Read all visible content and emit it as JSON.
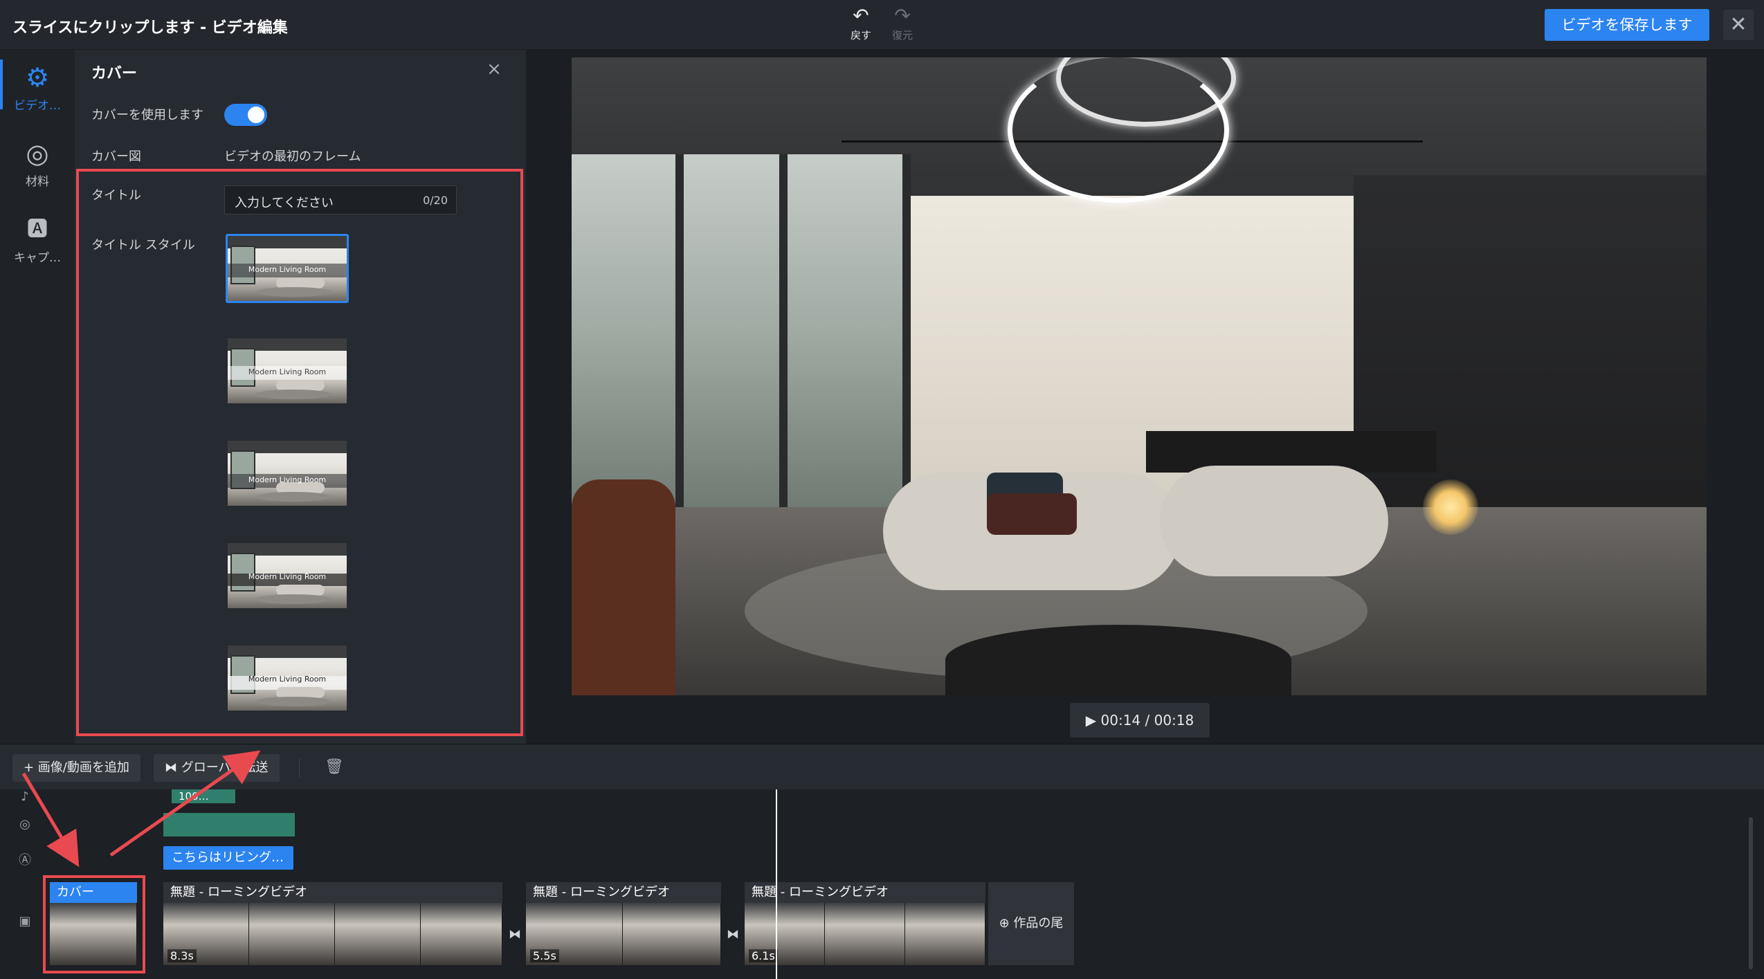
{
  "window": {
    "title": "スライスにクリップします - ビデオ編集",
    "undo_label": "戻す",
    "redo_label": "復元",
    "save_label": "ビデオを保存します",
    "close_icon": "close-icon"
  },
  "rail": {
    "items": [
      {
        "icon": "gear-icon",
        "label": "ビデオ…",
        "active": true
      },
      {
        "icon": "material-icon",
        "label": "材料",
        "active": false
      },
      {
        "icon": "caption-icon",
        "label": "キャプ…",
        "active": false
      }
    ]
  },
  "panel": {
    "title": "カバー",
    "use_cover_label": "カバーを使用します",
    "use_cover_on": true,
    "cover_image_label": "カバー図",
    "cover_image_value": "ビデオの最初のフレーム",
    "title_label": "タイトル",
    "title_placeholder": "入力してください",
    "title_count": "0/20",
    "title_style_label": "タイトル スタイル",
    "styles": [
      {
        "text": "Modern Living Room",
        "selected": true
      },
      {
        "text": "Modern Living Room",
        "selected": false
      },
      {
        "text": "Modern Living Room",
        "selected": false
      },
      {
        "text": "Modern Living Room",
        "selected": false
      },
      {
        "text": "Modern Living Room",
        "selected": false
      }
    ]
  },
  "preview": {
    "time": "00:14 / 00:18",
    "play_icon": "play-icon"
  },
  "toolbar": {
    "add_media_label": "+ 画像/動画を追加",
    "global_transition_label": "グローバル転送",
    "delete_icon": "trash-icon"
  },
  "timeline": {
    "bgm_clip": "100…",
    "caption_clip": "こちらはリビング…",
    "cover_clip": "カバー",
    "clips": [
      {
        "label": "無題 - ローミングビデオ",
        "duration": "8.3s"
      },
      {
        "label": "無題 - ローミングビデオ",
        "duration": "5.5s"
      },
      {
        "label": "無題 - ローミングビデオ",
        "duration": "6.1s"
      }
    ],
    "end_label": "作品の尾"
  },
  "accent": "#2c84f1",
  "highlight": "#e94a4f"
}
